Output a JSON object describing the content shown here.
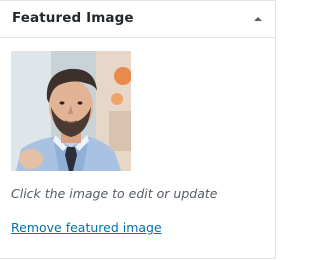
{
  "panel": {
    "title": "Featured Image",
    "toggle_icon": "caret-up-icon"
  },
  "image": {
    "icon": "featured-image-thumbnail"
  },
  "hint_text": "Click the image to edit or update",
  "remove_link_label": "Remove featured image",
  "colors": {
    "title": "#23282d",
    "hint": "#555d66",
    "link": "#0073aa",
    "border": "#e2e4e7"
  }
}
